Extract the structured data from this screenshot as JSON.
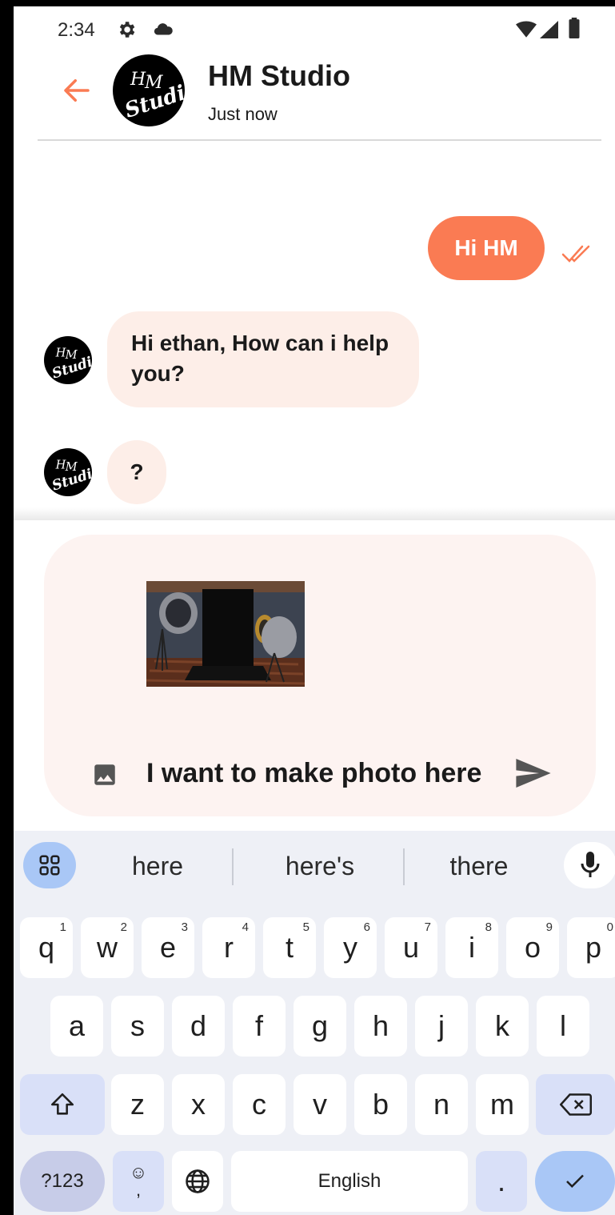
{
  "status_bar": {
    "time": "2:34",
    "icons": [
      "settings-icon",
      "cloud-icon",
      "wifi-icon",
      "signal-icon",
      "battery-icon"
    ]
  },
  "header": {
    "back_icon": "arrow-left-icon",
    "avatar_text": "HM Studio",
    "title": "HM Studio",
    "subtitle": "Just now"
  },
  "messages": [
    {
      "from": "me",
      "text": "Hi HM",
      "status_icon": "double-check-icon"
    },
    {
      "from": "studio",
      "text": "Hi ethan, How can i help you?"
    },
    {
      "from": "studio",
      "text": "?"
    }
  ],
  "composer": {
    "attachment": "studio-photo",
    "gallery_icon": "image-icon",
    "input_value": "I want to make photo here",
    "send_icon": "send-icon"
  },
  "keyboard": {
    "suggestions": [
      "here",
      "here's",
      "there"
    ],
    "row1": [
      {
        "k": "q",
        "h": "1"
      },
      {
        "k": "w",
        "h": "2"
      },
      {
        "k": "e",
        "h": "3"
      },
      {
        "k": "r",
        "h": "4"
      },
      {
        "k": "t",
        "h": "5"
      },
      {
        "k": "y",
        "h": "6"
      },
      {
        "k": "u",
        "h": "7"
      },
      {
        "k": "i",
        "h": "8"
      },
      {
        "k": "o",
        "h": "9"
      },
      {
        "k": "p",
        "h": "0"
      }
    ],
    "row2": [
      "a",
      "s",
      "d",
      "f",
      "g",
      "h",
      "j",
      "k",
      "l"
    ],
    "row3": [
      "z",
      "x",
      "c",
      "v",
      "b",
      "n",
      "m"
    ],
    "symbols_label": "?123",
    "emoji_label": "☺",
    "comma_label": ",",
    "space_label": "English",
    "period_label": "."
  },
  "colors": {
    "accent": "#fa7b53",
    "incoming_bubble": "#fdeee8",
    "composer_bg": "#fdf3f1",
    "keyboard_bg": "#eef0f6"
  }
}
